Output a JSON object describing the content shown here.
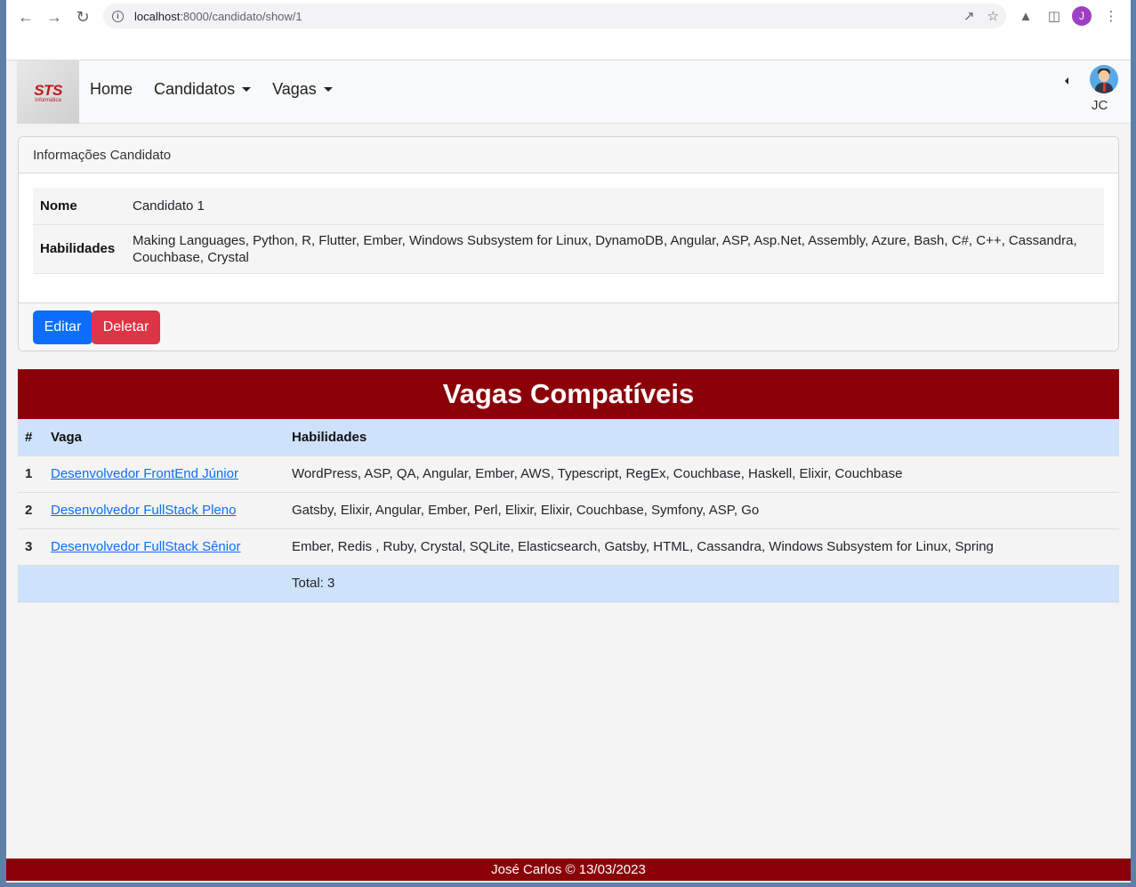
{
  "browser": {
    "url_host": "localhost",
    "url_rest": ":8000/candidato/show/1",
    "profile_initial": "J",
    "back_icon": "arrow-left-icon",
    "forward_icon": "arrow-right-icon",
    "reload_icon": "reload-icon"
  },
  "navbar": {
    "logo_text": "STS",
    "logo_subtext": "Informática",
    "links": [
      "Home",
      "Candidatos",
      "Vagas"
    ],
    "user_initials": "JC"
  },
  "card": {
    "header": "Informações Candidato",
    "rows": [
      {
        "label": "Nome",
        "value": "Candidato 1"
      },
      {
        "label": "Habilidades",
        "value": "Making Languages, Python, R, Flutter, Ember, Windows Subsystem for Linux, DynamoDB, Angular, ASP, Asp.Net, Assembly, Azure, Bash, C#, C++, Cassandra, Couchbase, Crystal"
      }
    ],
    "edit_label": "Editar",
    "delete_label": "Deletar"
  },
  "vagas": {
    "title": "Vagas Compatíveis",
    "headers": [
      "#",
      "Vaga",
      "Habilidades"
    ],
    "rows": [
      {
        "num": "1",
        "vaga": "Desenvolvedor FrontEnd Júnior",
        "habilidades": "WordPress, ASP, QA, Angular, Ember, AWS, Typescript, RegEx, Couchbase, Haskell, Elixir, Couchbase"
      },
      {
        "num": "2",
        "vaga": "Desenvolvedor FullStack Pleno",
        "habilidades": "Gatsby, Elixir, Angular, Ember, Perl, Elixir, Elixir, Couchbase, Symfony, ASP, Go"
      },
      {
        "num": "3",
        "vaga": "Desenvolvedor FullStack Sênior",
        "habilidades": "Ember, Redis , Ruby, Crystal, SQLite, Elasticsearch, Gatsby, HTML, Cassandra, Windows Subsystem for Linux, Spring"
      }
    ],
    "total": "Total: 3"
  },
  "footer": "José Carlos © 13/03/2023",
  "colors": {
    "brand": "#8b0008",
    "primary": "#0d6efd",
    "danger": "#dc3545",
    "table_head": "#cfe2fb"
  }
}
